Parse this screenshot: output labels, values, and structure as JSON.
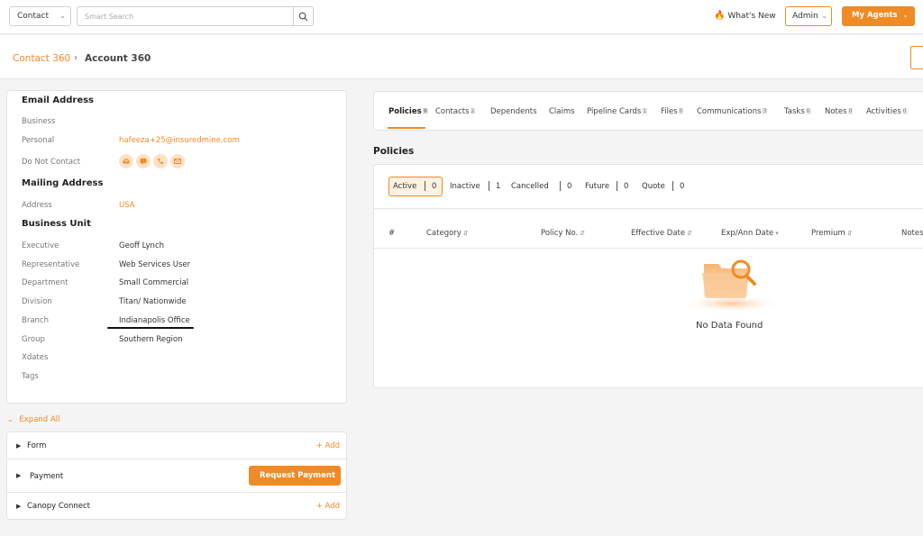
{
  "topbar": {
    "entity_select": "Contact",
    "search_placeholder": "Smart Search",
    "whats_new": "What's New",
    "admin": "Admin",
    "my_agents": "My Agents"
  },
  "breadcrumb": {
    "parent": "Contact 360",
    "current": "Account 360"
  },
  "details": {
    "email_title": "Email Address",
    "business_label": "Business",
    "personal_label": "Personal",
    "personal_value": "hafeeza+25@insuredmine.com",
    "dnc_label": "Do Not Contact",
    "mailing_title": "Mailing Address",
    "address_label": "Address",
    "address_value": "USA",
    "bu_title": "Business Unit",
    "rows": [
      {
        "label": "Executive",
        "value": "Geoff Lynch"
      },
      {
        "label": "Representative",
        "value": "Web Services User"
      },
      {
        "label": "Department",
        "value": "Small Commercial"
      },
      {
        "label": "Division",
        "value": "Titan/ Nationwide"
      },
      {
        "label": "Branch",
        "value": "Indianapolis Office"
      },
      {
        "label": "Group",
        "value": "Southern Region"
      },
      {
        "label": "Xdates",
        "value": ""
      },
      {
        "label": "Tags",
        "value": ""
      }
    ]
  },
  "accordion": {
    "expand_all": "Expand All",
    "form_title": "Form",
    "form_add": "+ Add",
    "payment_title": "Payment",
    "payment_btn": "Request Payment",
    "canopy_title": "Canopy Connect",
    "canopy_add": "+ Add"
  },
  "tabs": [
    {
      "label": "Policies",
      "badge": "0"
    },
    {
      "label": "Contacts",
      "badge": "2"
    },
    {
      "label": "Dependents",
      "badge": ""
    },
    {
      "label": "Claims",
      "badge": ""
    },
    {
      "label": "Pipeline Cards",
      "badge": "1"
    },
    {
      "label": "Files",
      "badge": "0"
    },
    {
      "label": "Communications",
      "badge": "3"
    },
    {
      "label": "Tasks",
      "badge": "0"
    },
    {
      "label": "Notes",
      "badge": "0"
    },
    {
      "label": "Activities",
      "badge": "0"
    }
  ],
  "policies": {
    "title": "Policies",
    "filters": [
      {
        "label": "Active",
        "count": "0"
      },
      {
        "label": "Inactive",
        "count": "1"
      },
      {
        "label": "Cancelled",
        "count": "0"
      },
      {
        "label": "Future",
        "count": "0"
      },
      {
        "label": "Quote",
        "count": "0"
      }
    ],
    "columns": [
      "#",
      "Category",
      "Policy No.",
      "Effective Date",
      "Exp/Ann Date",
      "Premium",
      "Notes"
    ],
    "empty_text": "No Data Found"
  },
  "colors": {
    "accent": "#f08a24"
  }
}
